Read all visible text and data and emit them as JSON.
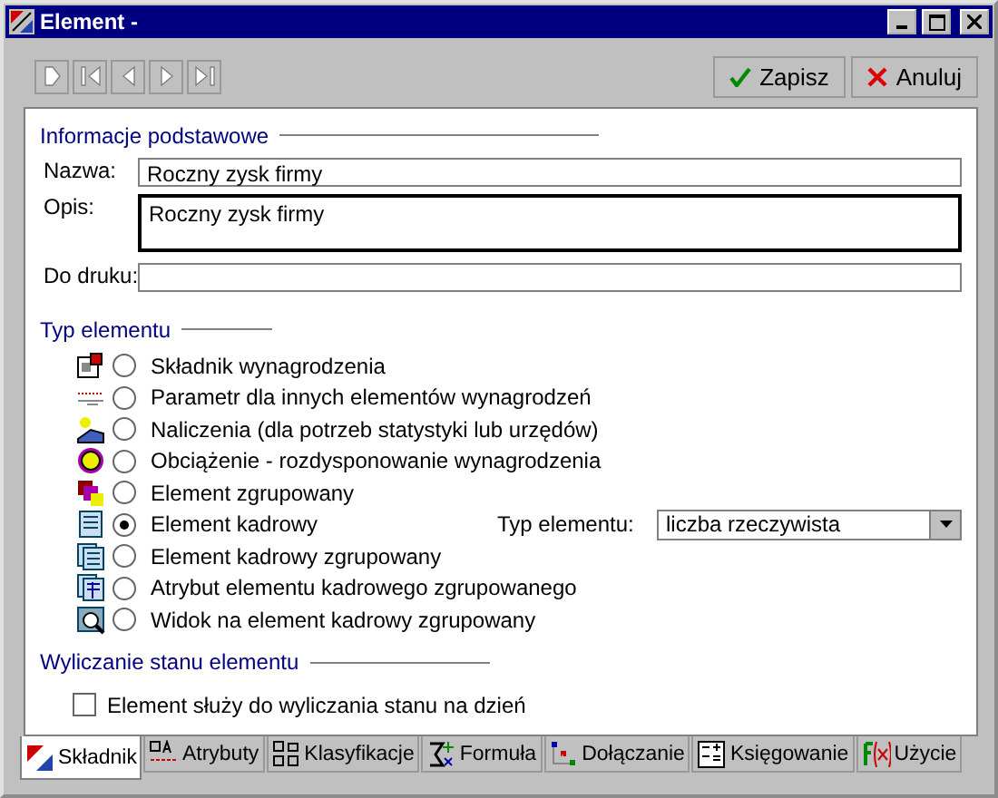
{
  "window": {
    "title": "Element -"
  },
  "nav_buttons": [
    {
      "disabled": true
    },
    {
      "disabled": true
    },
    {
      "disabled": true
    },
    {
      "disabled": true
    },
    {
      "disabled": true
    }
  ],
  "actions": [
    {
      "kind": "save",
      "label": "Zapisz"
    },
    {
      "kind": "cancel",
      "label": "Anuluj"
    }
  ],
  "basic_info": {
    "heading": "Informacje podstawowe",
    "name_label": "Nazwa:",
    "name_value": "Roczny zysk firmy",
    "description_label": "Opis:",
    "description_value": "Roczny zysk firmy",
    "print_label": "Do druku:"
  },
  "element_type": {
    "heading": "Typ elementu",
    "options": [
      {
        "label": "Składnik wynagrodzenia",
        "selected": false
      },
      {
        "label": "Parametr dla innych elementów wynagrodzeń",
        "selected": false
      },
      {
        "label": "Naliczenia (dla potrzeb statystyki lub urzędów)",
        "selected": false
      },
      {
        "label": "Obciążenie - rozdysponowanie wynagrodzenia",
        "selected": false
      },
      {
        "label": "Element zgrupowany",
        "selected": false
      },
      {
        "label": "Element kadrowy",
        "selected": true,
        "field": {
          "label": "Typ elementu:",
          "value": "liczba rzeczywista"
        }
      },
      {
        "label": "Element kadrowy zgrupowany",
        "selected": false
      },
      {
        "label": "Atrybut elementu kadrowego zgrupowanego",
        "selected": false
      },
      {
        "label": "Widok na element kadrowy zgrupowany",
        "selected": false
      }
    ]
  },
  "state_calc": {
    "heading": "Wyliczanie stanu elementu",
    "checkbox": {
      "label": "Element służy do wyliczania stanu na dzień",
      "checked": false
    }
  },
  "tabs": [
    {
      "label": "Składnik",
      "selected": true
    },
    {
      "label": "Atrybuty",
      "selected": false
    },
    {
      "label": "Klasyfikacje",
      "selected": false
    },
    {
      "label": "Formuła",
      "selected": false
    },
    {
      "label": "Dołączanie",
      "selected": false
    },
    {
      "label": "Księgowanie",
      "selected": false
    },
    {
      "label": "Użycie",
      "selected": false
    }
  ]
}
